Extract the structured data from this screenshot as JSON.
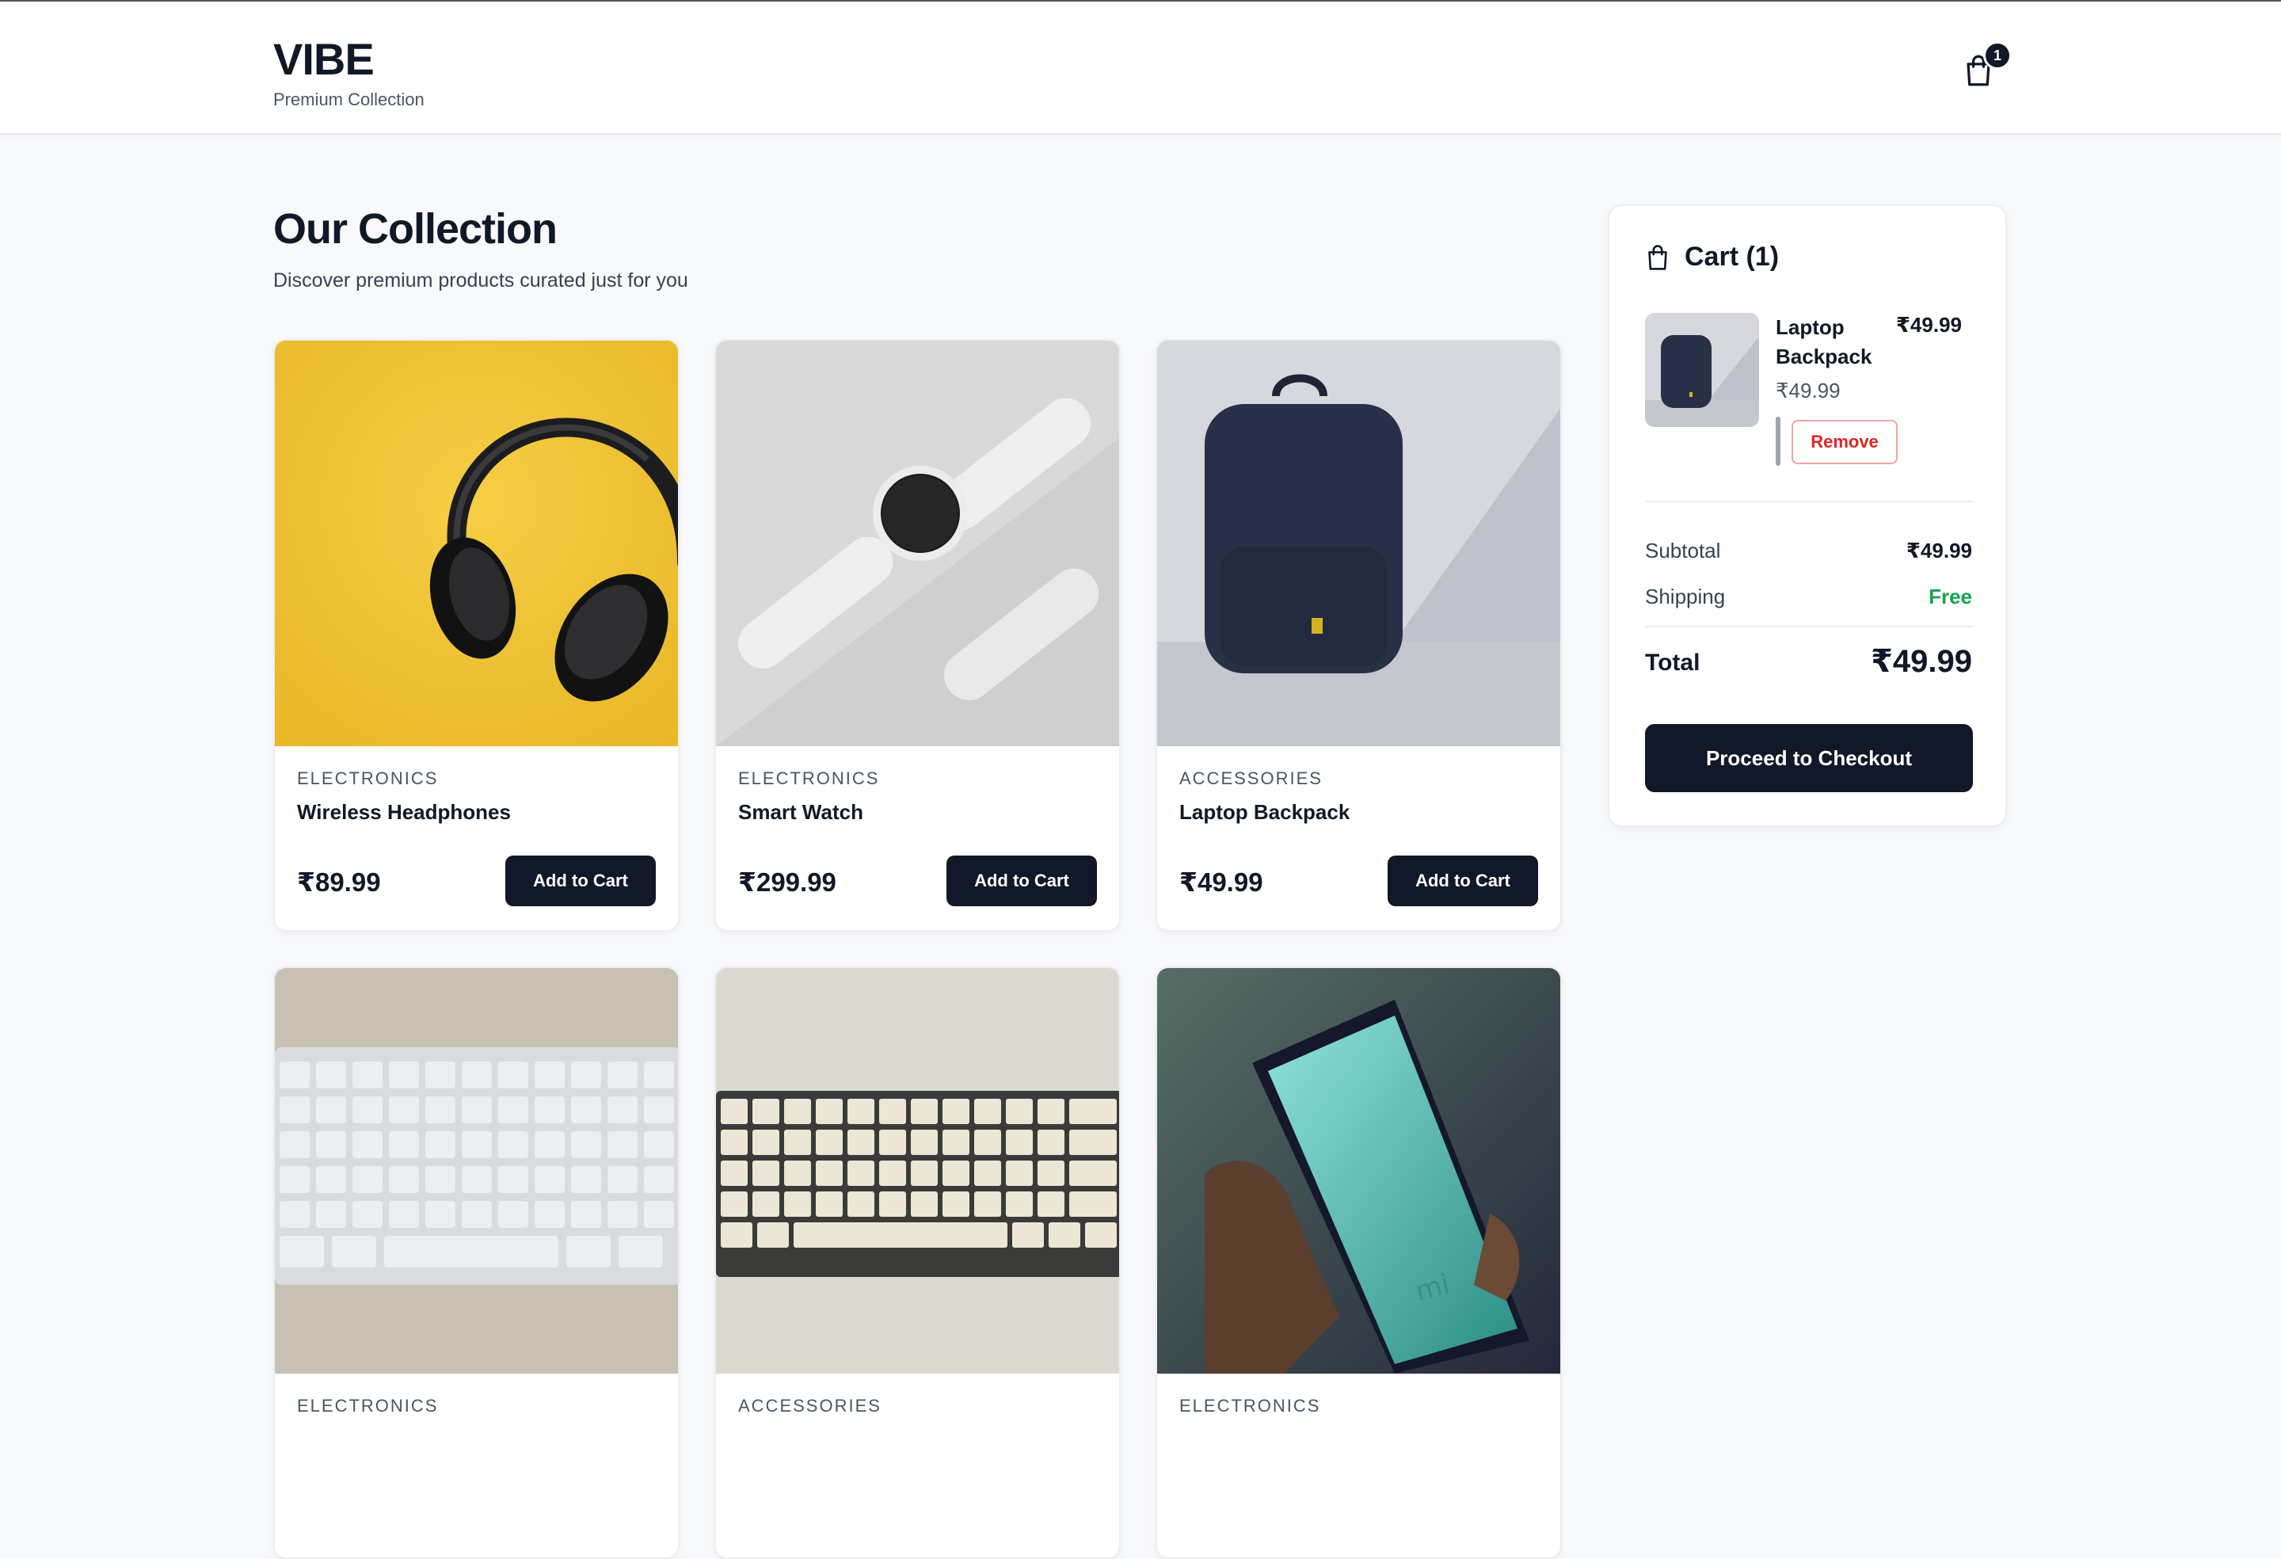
{
  "header": {
    "brand": "VIBE",
    "tagline": "Premium Collection",
    "cart_count": "1"
  },
  "main": {
    "title": "Our Collection",
    "subtitle": "Discover premium products curated just for you"
  },
  "products": [
    {
      "category": "ELECTRONICS",
      "name": "Wireless Headphones",
      "price": "₹89.99",
      "button": "Add to Cart",
      "image": "headphones-image"
    },
    {
      "category": "ELECTRONICS",
      "name": "Smart Watch",
      "price": "₹299.99",
      "button": "Add to Cart",
      "image": "smartwatch-image"
    },
    {
      "category": "ACCESSORIES",
      "name": "Laptop Backpack",
      "price": "₹49.99",
      "button": "Add to Cart",
      "image": "backpack-image"
    },
    {
      "category": "ELECTRONICS",
      "image": "keyboard-image"
    },
    {
      "category": "ACCESSORIES",
      "image": "mechanical-keyboard-image"
    },
    {
      "category": "ELECTRONICS",
      "image": "phone-image"
    }
  ],
  "cart": {
    "title": "Cart (1)",
    "items": [
      {
        "name": "Laptop Backpack",
        "unit_price": "₹49.99",
        "line_total": "₹49.99",
        "remove_label": "Remove"
      }
    ],
    "subtotal_label": "Subtotal",
    "subtotal_value": "₹49.99",
    "shipping_label": "Shipping",
    "shipping_value": "Free",
    "total_label": "Total",
    "total_value": "₹49.99",
    "checkout_label": "Proceed to Checkout"
  },
  "colors": {
    "primary": "#111827",
    "background": "#f8f9fb",
    "success": "#16a34a",
    "danger": "#dc2626"
  }
}
